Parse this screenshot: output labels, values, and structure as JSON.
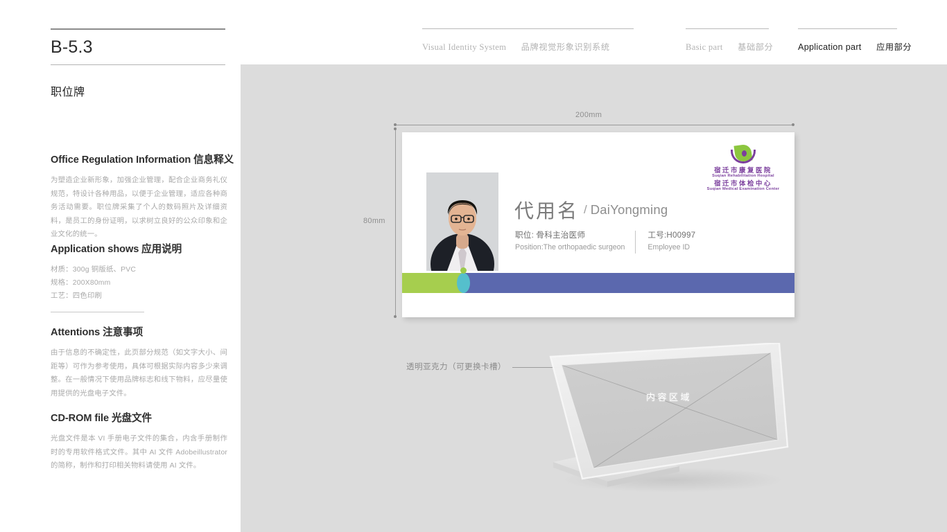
{
  "nav": {
    "visual": {
      "en": "Visual Identity System",
      "cn": "品牌视觉形象识别系统"
    },
    "basic": {
      "en": "Basic part",
      "cn": "基础部分"
    },
    "application": {
      "en": "Application part",
      "cn": "应用部分"
    }
  },
  "sidebar": {
    "code": "B-5.3",
    "section_title": "职位牌",
    "info": {
      "heading": "Office Regulation Information 信息释义",
      "body": "为塑造企业新形象，加强企业管理，配合企业商务礼仪规范，特设计各种用品，以便于企业管理，适应各种商务活动需要。职位牌采集了个人的数码照片及详细资料，是员工的身份证明，以求树立良好的公众印象和企业文化的统一。"
    },
    "application": {
      "heading": "Application shows 应用说明",
      "specs": [
        "材质：300g 铜版纸、PVC",
        "规格：200X80mm",
        "工艺：四色印刷"
      ]
    },
    "attentions": {
      "heading": "Attentions 注意事项",
      "body": "由于信息的不确定性，此页部分规范（如文字大小、间距等）可作为参考使用，具体可根据实际内容多少来调整。在一般情况下使用品牌标志和线下物料，应尽量使用提供的光盘电子文件。"
    },
    "cdrom": {
      "heading": "CD-ROM file 光盘文件",
      "body": "光盘文件是本 VI 手册电子文件的集合，内含手册制作时的专用软件格式文件。其中 AI 文件 Adobeillustrator 的简称，制作和打印相关物料请使用 AI 文件。"
    }
  },
  "stage": {
    "dimensions": {
      "width_label": "200mm",
      "height_label": "80mm"
    },
    "callout": "透明亚克力（可更换卡槽）",
    "stand_label": "内容区域"
  },
  "card": {
    "name_cn": "代用名",
    "name_sep": "/",
    "name_en": "DaiYongming",
    "position_cn": "职位: 骨科主治医师",
    "position_en": "Position:The orthopaedic surgeon",
    "employee_no_cn": "工号:H00997",
    "employee_no_en": "Employee ID",
    "logo": {
      "line1_cn": "宿迁市康复医院",
      "line1_en": "Suqian Rehabilitation Hospital",
      "line2_cn": "宿迁市体检中心",
      "line2_en": "Suqian Medical Examination Center"
    }
  },
  "colors": {
    "brand_purple": "#7b3f9d",
    "bar_green": "#a6ce4e",
    "bar_teal": "#55bfcc",
    "bar_blue": "#5b68ae",
    "stage_gray": "#dcdcdc"
  }
}
